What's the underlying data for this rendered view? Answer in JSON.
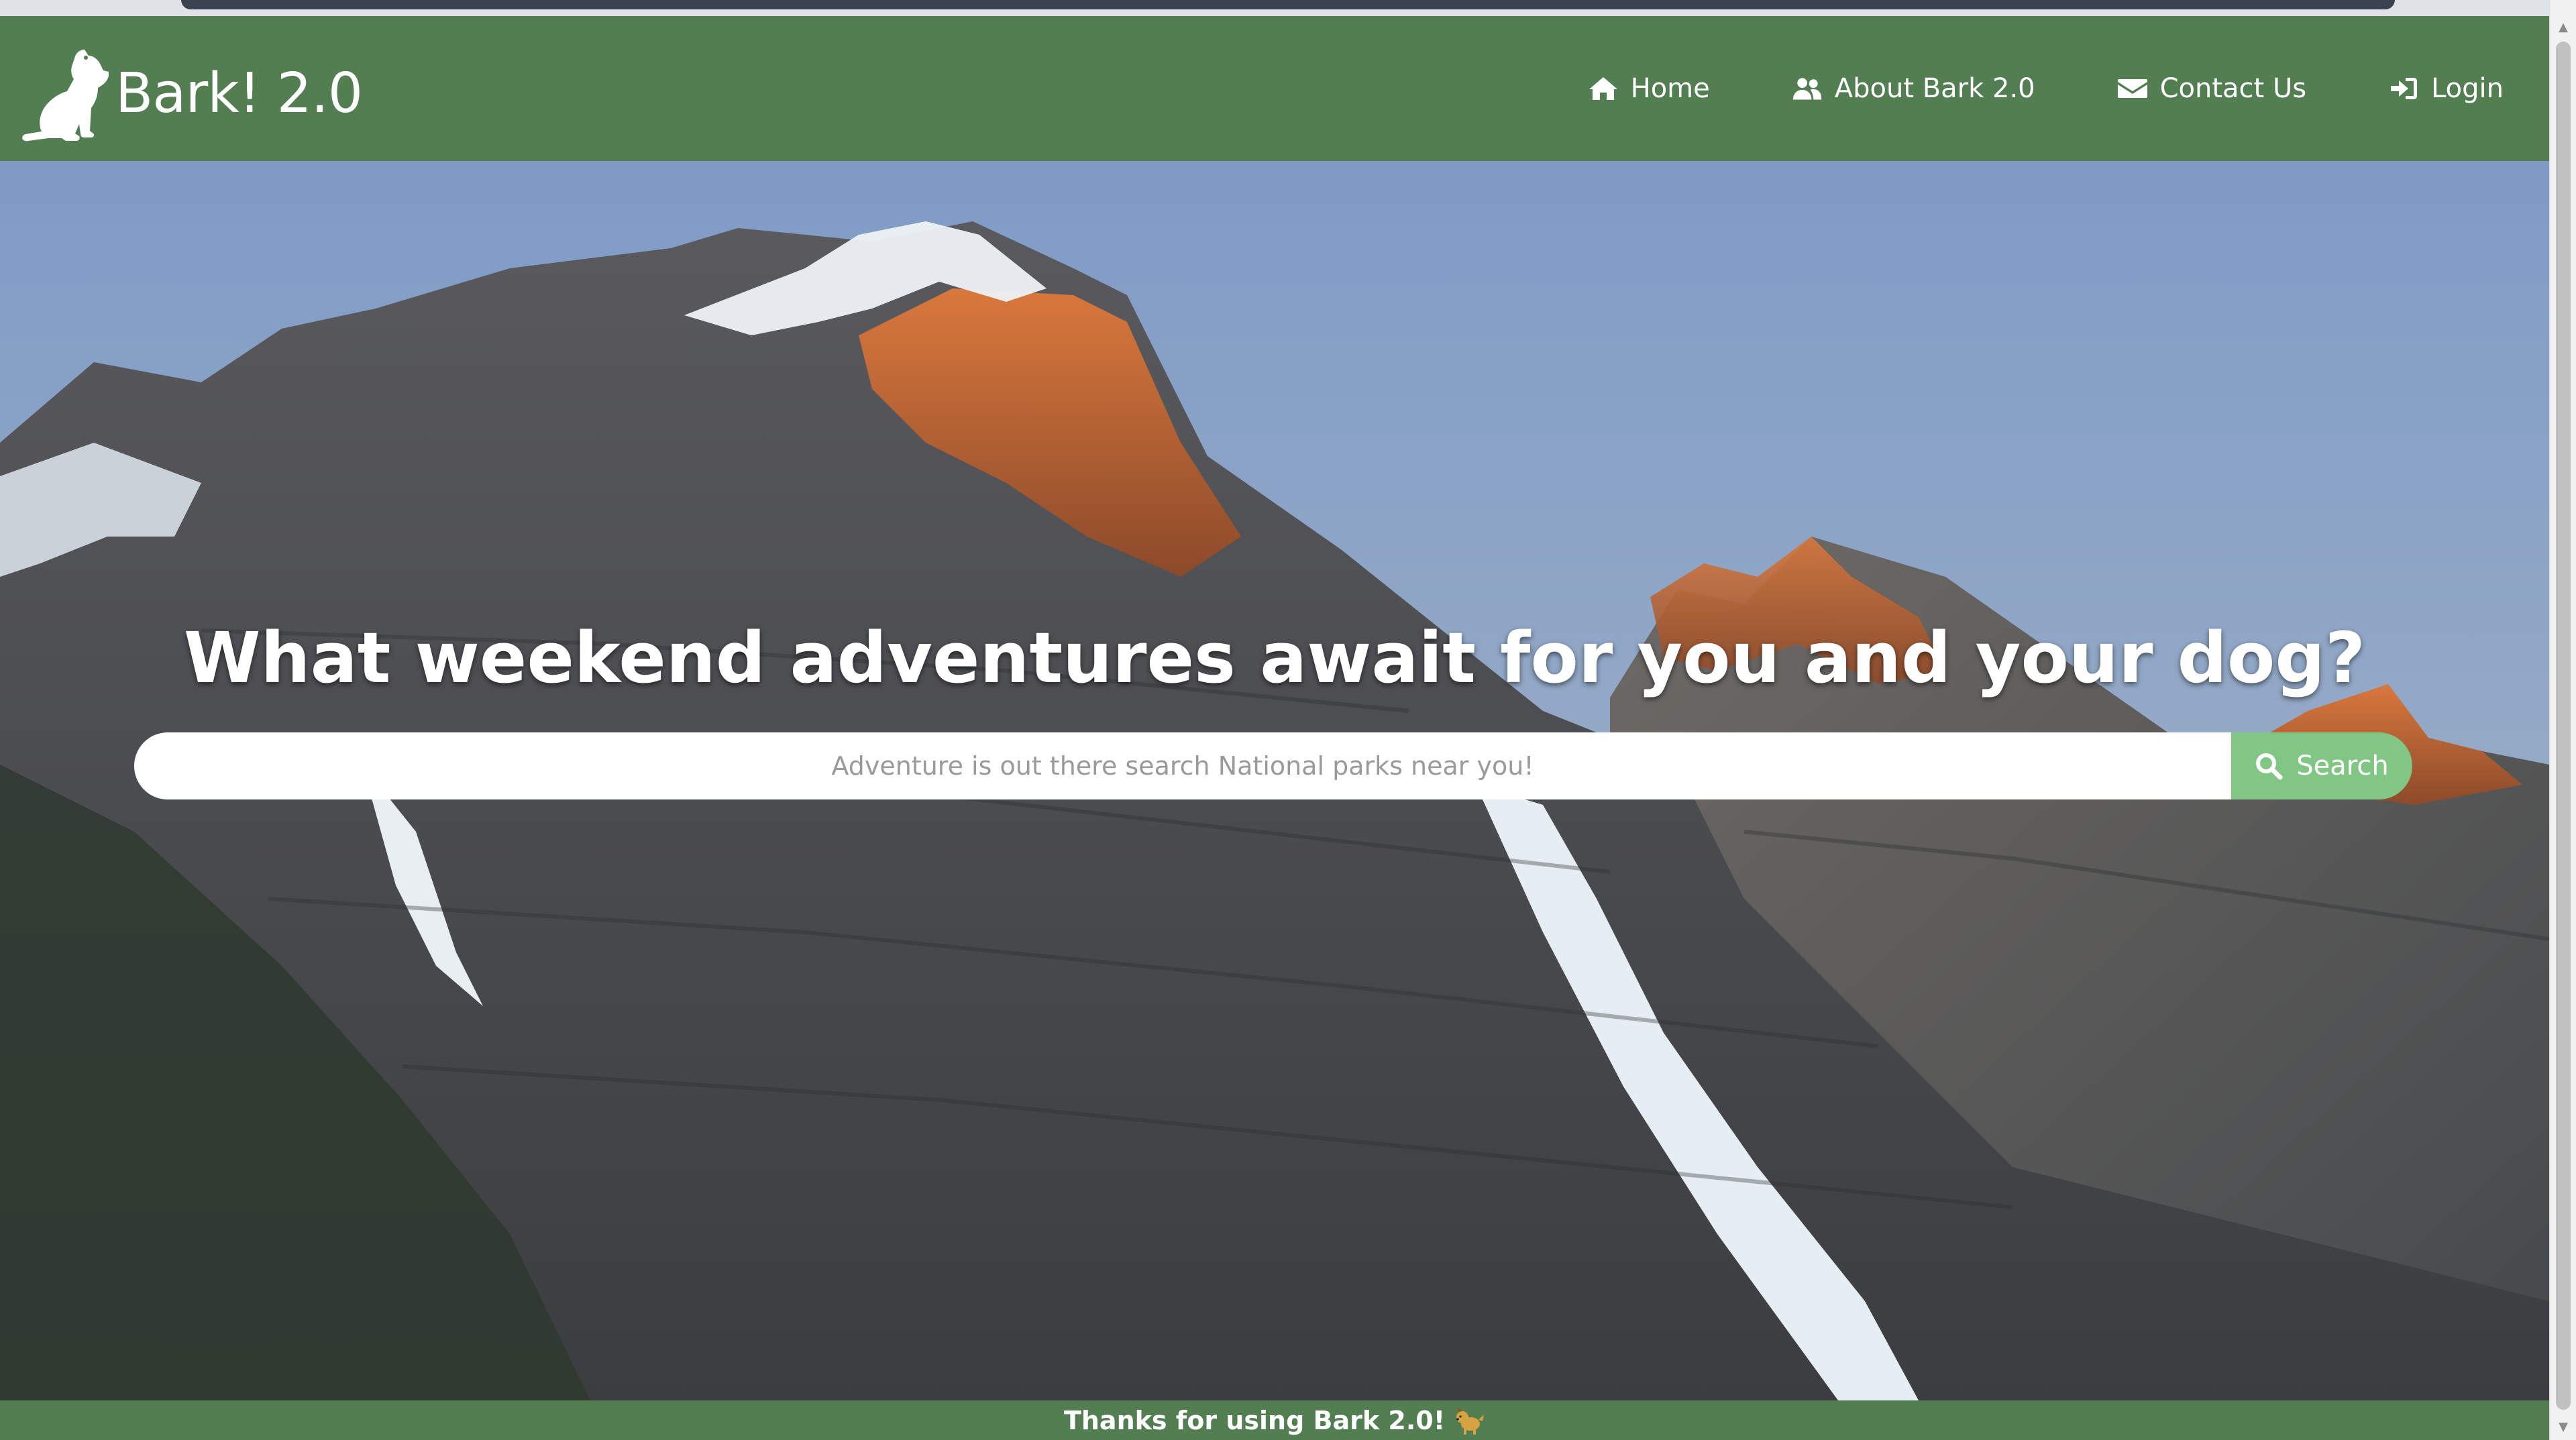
{
  "brand": {
    "name": "Bark! 2.0",
    "logo_icon": "dog-icon"
  },
  "nav": [
    {
      "label": "Home",
      "icon": "home-icon"
    },
    {
      "label": "About Bark 2.0",
      "icon": "users-icon"
    },
    {
      "label": "Contact Us",
      "icon": "envelope-icon"
    },
    {
      "label": "Login",
      "icon": "sign-in-icon"
    }
  ],
  "hero": {
    "headline": "What weekend adventures await for you and your dog?",
    "search": {
      "placeholder": "Adventure is out there search National parks near you!",
      "value": "",
      "button_label": "Search",
      "button_icon": "search-icon"
    }
  },
  "footer": {
    "text": "Thanks for using Bark 2.0!",
    "emoji_icon": "dog-emoji-icon"
  },
  "colors": {
    "navbar": "#527e52",
    "search_button": "#82c685",
    "text": "#ffffff"
  }
}
